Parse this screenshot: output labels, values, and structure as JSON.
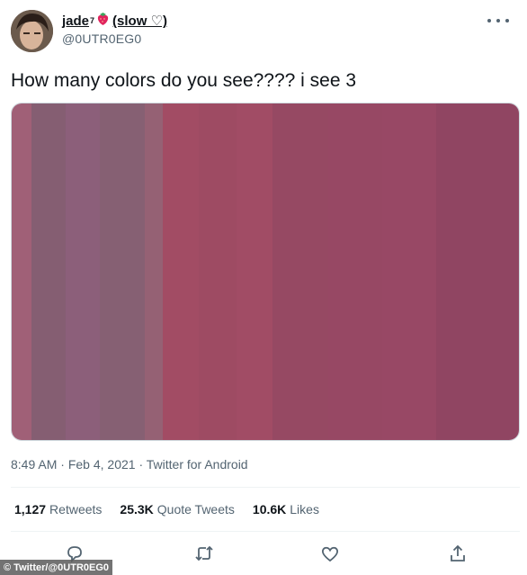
{
  "tweet": {
    "display_name": "jade",
    "superscript": "7",
    "name_suffix": "(slow ♡)",
    "handle": "@0UTR0EG0",
    "text": "How many colors do you see???? i see 3",
    "time": "8:49 AM",
    "date": "Feb 4, 2021",
    "source": "Twitter for Android",
    "meta_sep": "·"
  },
  "stats": {
    "retweets_count": "1,127",
    "retweets_label": "Retweets",
    "quotes_count": "25.3K",
    "quotes_label": "Quote Tweets",
    "likes_count": "10.6K",
    "likes_label": "Likes"
  },
  "media": {
    "stripes": [
      "#a06077",
      "#855e72",
      "#8c5f7a",
      "#866073",
      "#956174",
      "#a24c64",
      "#9e4b63",
      "#a14c65",
      "#964963",
      "#974864",
      "#984865",
      "#904562"
    ]
  },
  "watermark": "© Twitter/@0UTR0EG0",
  "icons": [
    "avatar-photo",
    "strawberry-icon",
    "more-options-icon",
    "reply-icon",
    "retweet-icon",
    "like-icon",
    "share-icon"
  ]
}
